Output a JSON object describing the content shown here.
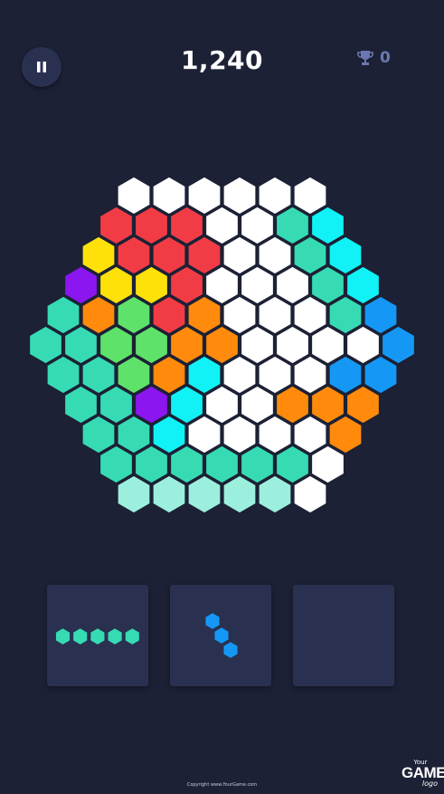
{
  "header": {
    "pause_icon": "pause-icon",
    "score": "1,240",
    "best_icon": "trophy-icon",
    "best_value": "0"
  },
  "colors": {
    "background": "#1c2135",
    "panel": "#2a3150",
    "white": "#ffffff",
    "red": "#f23c45",
    "yellow": "#ffe10a",
    "purple": "#8b16f0",
    "orange": "#ff8a0c",
    "green": "#5ee26a",
    "teal": "#36dbb4",
    "cyan": "#10f2f5",
    "blue": "#1598f5",
    "mint": "#9cefdc"
  },
  "board": {
    "rows": [
      [
        "white",
        "white",
        "white",
        "white",
        "white",
        "white"
      ],
      [
        "red",
        "red",
        "red",
        "white",
        "white",
        "teal",
        "cyan"
      ],
      [
        "yellow",
        "red",
        "red",
        "red",
        "white",
        "white",
        "teal",
        "cyan"
      ],
      [
        "purple",
        "yellow",
        "yellow",
        "red",
        "white",
        "white",
        "white",
        "teal",
        "cyan"
      ],
      [
        "teal",
        "orange",
        "green",
        "red",
        "orange",
        "white",
        "white",
        "white",
        "teal",
        "blue"
      ],
      [
        "teal",
        "teal",
        "green",
        "green",
        "orange",
        "orange",
        "white",
        "white",
        "white",
        "white",
        "blue"
      ],
      [
        "teal",
        "teal",
        "green",
        "orange",
        "cyan",
        "white",
        "white",
        "white",
        "blue",
        "blue"
      ],
      [
        "teal",
        "teal",
        "purple",
        "cyan",
        "white",
        "white",
        "orange",
        "orange",
        "orange"
      ],
      [
        "teal",
        "teal",
        "cyan",
        "white",
        "white",
        "white",
        "white",
        "orange"
      ],
      [
        "teal",
        "teal",
        "teal",
        "teal",
        "teal",
        "teal",
        "white"
      ],
      [
        "mint",
        "mint",
        "mint",
        "mint",
        "mint",
        "white"
      ]
    ]
  },
  "pieces": [
    {
      "color": "teal",
      "shape": "straight-5"
    },
    {
      "color": "blue",
      "shape": "diagonal-3"
    },
    {
      "color": "",
      "shape": "empty"
    }
  ],
  "footer": {
    "copyright": "Copyright www.YourGame.com",
    "logo_your": "Your",
    "logo_game": "GAME",
    "logo_logo": "logo"
  }
}
